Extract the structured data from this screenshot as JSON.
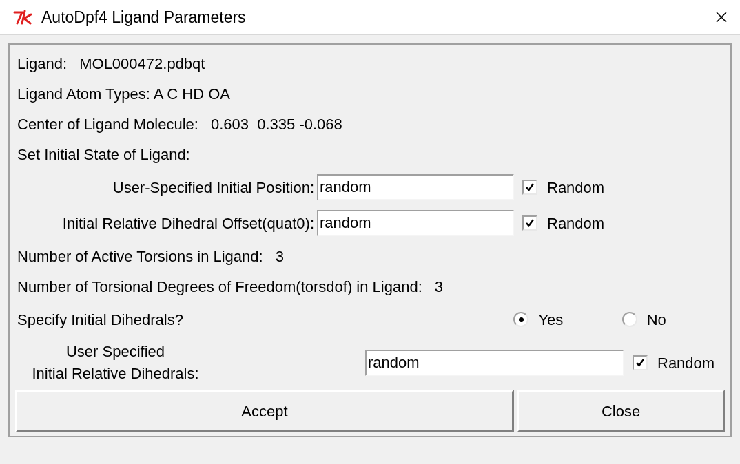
{
  "window": {
    "title": "AutoDpf4 Ligand Parameters"
  },
  "rows": [
    {
      "kind": "info",
      "label": "Ligand:",
      "value": "MOL000472.pdbqt"
    },
    {
      "kind": "text",
      "label": "Ligand Atom Types: A C HD OA"
    },
    {
      "kind": "info",
      "label": "Center of Ligand Molecule:",
      "value": "0.603  0.335 -0.068"
    },
    {
      "kind": "text",
      "label": "Set Initial State of Ligand:"
    },
    {
      "kind": "field",
      "label": "User-Specified Initial Position:",
      "value": "random",
      "checkbox": "Random",
      "checked": true
    },
    {
      "kind": "field",
      "label": "Initial Relative Dihedral Offset(quat0):",
      "value": "random",
      "checkbox": "Random",
      "checked": true
    },
    {
      "kind": "info",
      "label": "Number of Active Torsions in Ligand:",
      "value": "3"
    },
    {
      "kind": "info",
      "label": "Number of Torsional Degrees of Freedom(torsdof) in Ligand:",
      "value": "3"
    },
    {
      "kind": "radio",
      "label": "Specify Initial Dihedrals?",
      "options": [
        {
          "label": "Yes",
          "selected": true
        },
        {
          "label": "No",
          "selected": false
        }
      ]
    },
    {
      "kind": "field2",
      "label_lines": [
        "User Specified",
        "Initial Relative Dihedrals:"
      ],
      "value": "random",
      "checkbox": "Random",
      "checked": true
    }
  ],
  "buttons": [
    "Accept",
    "Close"
  ]
}
